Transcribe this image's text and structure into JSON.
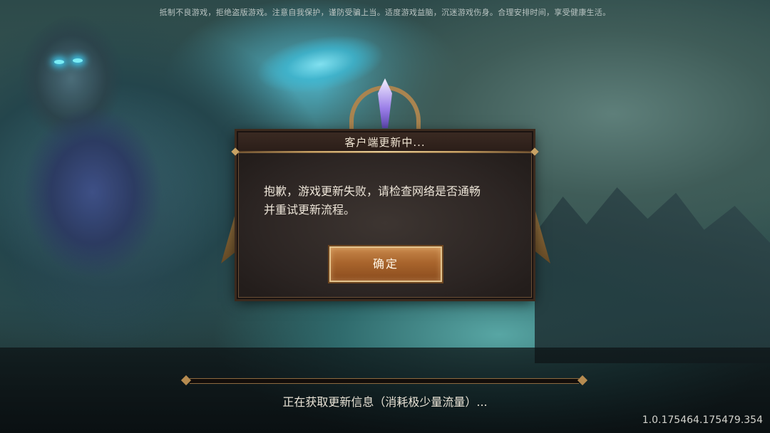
{
  "notice": "抵制不良游戏，拒绝盗版游戏。注意自我保护，谨防受骗上当。适度游戏益脑，沉迷游戏伤身。合理安排时间，享受健康生活。",
  "dialog": {
    "title": "客户端更新中...",
    "message_line1": "抱歉，游戏更新失败，请检查网络是否通畅",
    "message_line2": "并重试更新流程。",
    "confirm_label": "确定"
  },
  "loading": {
    "status": "正在获取更新信息（消耗极少量流量）...",
    "progress": 0
  },
  "version": "1.0.175464.175479.354"
}
